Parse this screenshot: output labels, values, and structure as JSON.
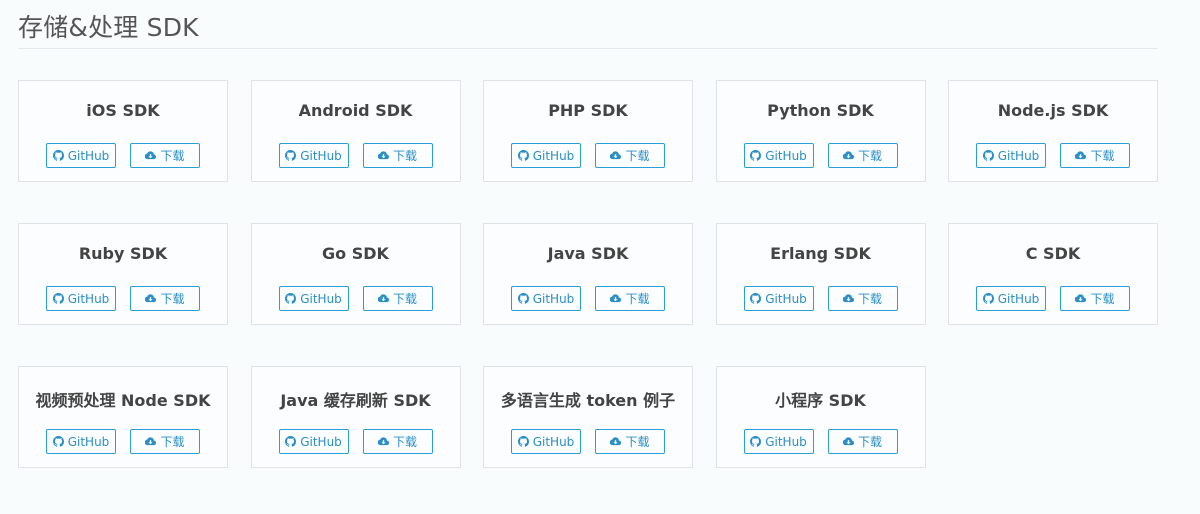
{
  "section": {
    "title": "存储&处理 SDK"
  },
  "colors": {
    "accent": "#2a9fd6",
    "border": "#dfe3e6",
    "background": "#f9fcfd"
  },
  "buttons": {
    "github_label": "GitHub",
    "download_label": "下载"
  },
  "icons": {
    "github": "github-icon",
    "download": "cloud-download-icon"
  },
  "sdks": [
    {
      "name": "iOS SDK"
    },
    {
      "name": "Android SDK"
    },
    {
      "name": "PHP SDK"
    },
    {
      "name": "Python SDK"
    },
    {
      "name": "Node.js SDK"
    },
    {
      "name": "Ruby SDK"
    },
    {
      "name": "Go SDK"
    },
    {
      "name": "Java SDK"
    },
    {
      "name": "Erlang SDK"
    },
    {
      "name": "C SDK"
    },
    {
      "name": "视频预处理 Node SDK"
    },
    {
      "name": "Java 缓存刷新 SDK"
    },
    {
      "name": "多语言生成 token 例子"
    },
    {
      "name": "小程序 SDK"
    }
  ]
}
